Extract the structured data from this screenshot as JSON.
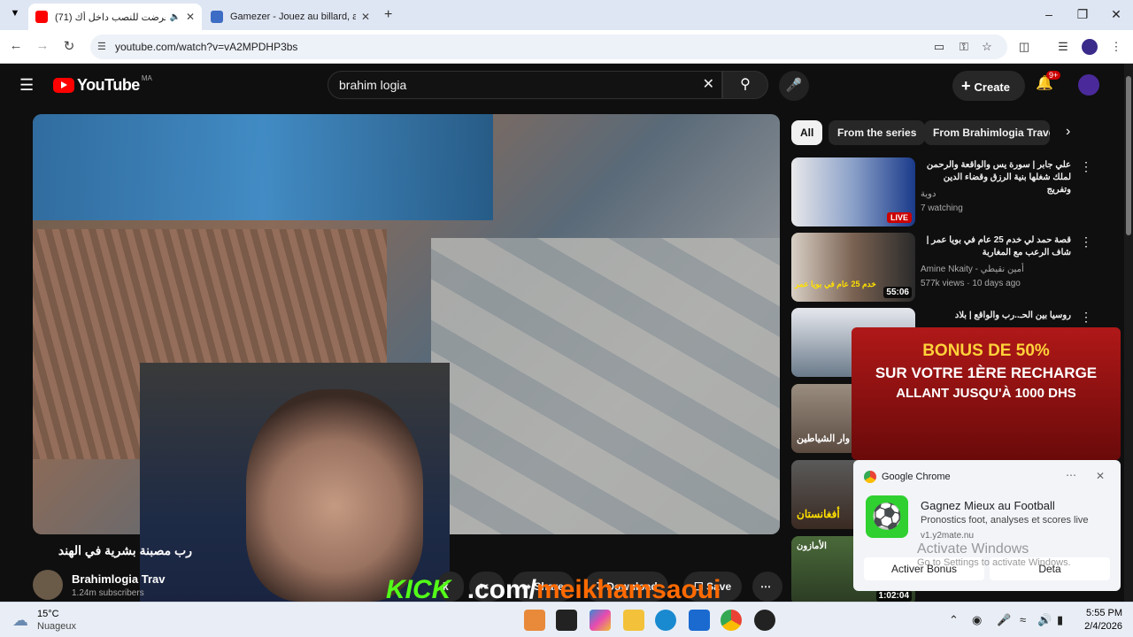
{
  "browser": {
    "tabs": [
      {
        "title": "(71) تعرضت للنصب داخل أك",
        "active": true
      },
      {
        "title": "Gamezer - Jouez au billard, aux",
        "active": false
      }
    ],
    "url": "youtube.com/watch?v=vA2MPDHP3bs"
  },
  "youtube": {
    "logo_text": "YouTube",
    "region": "MA",
    "search_value": "brahim logia",
    "create_label": "Create",
    "notif_badge": "9+",
    "chips": [
      "All",
      "From the series",
      "From Brahimlogia Travels"
    ],
    "video_title": "رب مصبنة بشرية في الهند",
    "channel_name": "Brahimlogia Trav",
    "subscribers": "1.24m subscribers",
    "actions": {
      "share": "Share",
      "download": "Download",
      "save": "Save",
      "partial": "k"
    },
    "recommendations": [
      {
        "title": "علي جابر | سورة يس والواقعة والرحمن لملك شغلها بنية الرزق وقضاء الدين وتفريج",
        "channel": "دوية",
        "meta": "7 watching",
        "badge": "LIVE"
      },
      {
        "title": "قصة حمد لي خدم 25 عام في بويا عمر | شاف الرعب مع المغاربة",
        "channel": "Amine Nkaity - أمين نقيطي",
        "meta": "577k views · 10 days ago",
        "duration": "55:06",
        "thumb_text": "خدم 25 عام في بويا عمر"
      },
      {
        "title": "روسيا بين الحـ..رب والواقع | بلاد",
        "channel": "",
        "meta": "",
        "duration": ""
      },
      {
        "title": "",
        "channel": "",
        "meta": "",
        "thumb_text": "وار الشياطين"
      },
      {
        "title": "",
        "channel": "",
        "meta": "",
        "thumb_text": "أفغانستان"
      },
      {
        "title": "",
        "channel": "",
        "meta": "",
        "duration": "1:02:04",
        "thumb_text": "الأمازون"
      }
    ]
  },
  "ad": {
    "line1": "BONUS DE 50%",
    "line2": "SUR VOTRE 1ÈRE RECHARGE",
    "line3": "ALLANT JUSQU'À 1000 DHS",
    "button": "Activer Bonus",
    "button2": "Deta"
  },
  "notification": {
    "app": "Google Chrome",
    "title": "Gagnez Mieux au Football",
    "body": "Pronostics foot, analyses et scores live",
    "source": "v1.y2mate.nu"
  },
  "watermark": {
    "line1": "Activate Windows",
    "line2": "Go to Settings to activate Windows."
  },
  "overlay_text": {
    "kick": "KICK",
    "dotcom": ".com/",
    "name": "meikhamsaoui"
  },
  "taskbar": {
    "weather_temp": "15°C",
    "weather_desc": "Nuageux",
    "time": "5:55 PM",
    "date": "2/4/2026"
  }
}
